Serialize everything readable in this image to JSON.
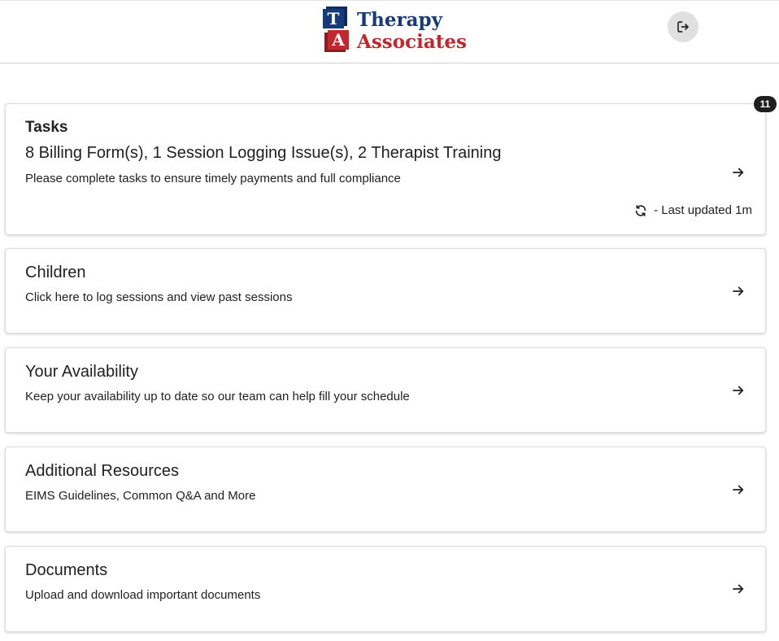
{
  "header": {
    "logo_line1": "Therapy",
    "logo_line2": "Associates",
    "logo_block_t": "T",
    "logo_block_a": "A",
    "logout_icon": "logout-icon"
  },
  "tasks": {
    "title": "Tasks",
    "summary": "8 Billing Form(s), 1 Session Logging Issue(s), 2 Therapist Training",
    "description": "Please complete tasks to ensure timely payments and full compliance",
    "badge_count": "11",
    "last_updated": "- Last updated 1m",
    "refresh_icon": "refresh-icon"
  },
  "cards": [
    {
      "title": "Children",
      "description": "Click here to log sessions and view past sessions"
    },
    {
      "title": "Your Availability",
      "description": "Keep your availability up to date so our team can help fill your schedule"
    },
    {
      "title": "Additional Resources",
      "description": "EIMS Guidelines, Common Q&A and More"
    },
    {
      "title": "Documents",
      "description": "Upload and download important documents"
    }
  ],
  "colors": {
    "brand_blue": "#163a7a",
    "brand_red": "#c1272d",
    "badge_bg": "#1f1f1f"
  }
}
